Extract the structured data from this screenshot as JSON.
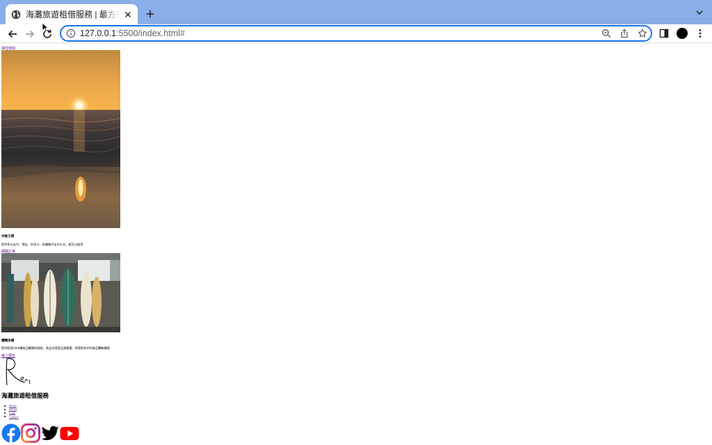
{
  "browser": {
    "tab": {
      "title": "海灘旅遊租借服務 | 最方便的海灘"
    },
    "address": {
      "host": "127.0.0.1",
      "rest": ":5500/index.html#"
    },
    "colors": {
      "tabstrip": "#8aaee8",
      "focus_ring": "#1a73e8"
    }
  },
  "page": {
    "section1": {
      "link": "彈性時間",
      "image": "sunset-beach-photo",
      "heading": "付款方便",
      "text": "提供多元支付、現金、信用卡、各種電子支付方式，都可以使用"
    },
    "section2": {
      "link": "網路訂單",
      "image": "surfboards-photo",
      "heading": "種類多樣",
      "text": "提供超過1000種商品種類的服務，商品均透過品質篩選，保證您有完的商品體驗價值"
    },
    "section3": {
      "link": "線上預定",
      "logo": "Rei"
    },
    "footer": {
      "title": "海灘旅遊租借服務",
      "nav": [
        "Home",
        "About",
        "Logo",
        "Contact"
      ],
      "social_icons": [
        "facebook-icon",
        "instagram-icon",
        "twitter-icon",
        "youtube-icon"
      ]
    }
  }
}
